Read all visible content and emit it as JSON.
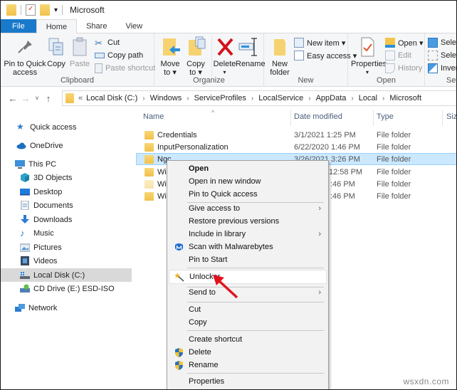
{
  "window": {
    "title": "Microsoft",
    "qat_dropdown": "▾"
  },
  "tabs": [
    {
      "label": "File"
    },
    {
      "label": "Home"
    },
    {
      "label": "Share"
    },
    {
      "label": "View"
    }
  ],
  "ribbon": {
    "clipboard": {
      "label": "Clipboard",
      "pin": "Pin to Quick access",
      "pin_line1": "Pin to Quick",
      "pin_line2": "access",
      "copy": "Copy",
      "paste": "Paste",
      "cut": "Cut",
      "copy_path": "Copy path",
      "paste_shortcut": "Paste shortcut"
    },
    "organize": {
      "label": "Organize",
      "move_to_1": "Move",
      "move_to_2": "to ▾",
      "copy_to_1": "Copy",
      "copy_to_2": "to ▾",
      "delete": "Delete",
      "delete_arrow": "▾",
      "rename": "Rename"
    },
    "new": {
      "label": "New",
      "new_folder_1": "New",
      "new_folder_2": "folder",
      "new_item": "New item ▾",
      "easy_access": "Easy access ▾"
    },
    "open": {
      "label": "Open",
      "properties": "Properties",
      "properties_arrow": "▾",
      "open": "Open ▾",
      "edit": "Edit",
      "history": "History"
    },
    "select": {
      "label": "Se",
      "select_all": "Selec",
      "select_none": "Selec",
      "invert": "Invert"
    }
  },
  "address": {
    "back": "←",
    "forward": "→",
    "recent": "˅",
    "up": "↑",
    "overflow": "«",
    "crumbs": [
      "Local Disk (C:)",
      "Windows",
      "ServiceProfiles",
      "LocalService",
      "AppData",
      "Local",
      "Microsoft"
    ],
    "separator": "›"
  },
  "navpane": {
    "items": [
      {
        "label": "Quick access",
        "icon": "star-icon"
      },
      {
        "label": "OneDrive",
        "icon": "cloud-icon"
      },
      {
        "label": "This PC",
        "icon": "computer-icon"
      },
      {
        "label": "3D Objects",
        "icon": "cube-icon"
      },
      {
        "label": "Desktop",
        "icon": "desktop-icon"
      },
      {
        "label": "Documents",
        "icon": "document-icon"
      },
      {
        "label": "Downloads",
        "icon": "download-icon"
      },
      {
        "label": "Music",
        "icon": "music-icon"
      },
      {
        "label": "Pictures",
        "icon": "picture-icon"
      },
      {
        "label": "Videos",
        "icon": "video-icon"
      },
      {
        "label": "Local Disk (C:)",
        "icon": "drive-icon",
        "selected": true
      },
      {
        "label": "CD Drive (E:) ESD-ISO",
        "icon": "cd-drive-icon"
      },
      {
        "label": "Network",
        "icon": "network-icon"
      }
    ]
  },
  "filelist": {
    "columns": [
      "Name",
      "Date modified",
      "Type",
      "Size"
    ],
    "sort_indicator": "^",
    "rows": [
      {
        "name": "Credentials",
        "date": "3/1/2021 1:25 PM",
        "type": "File folder"
      },
      {
        "name": "InputPersonalization",
        "date": "6/22/2020 1:46 PM",
        "type": "File folder"
      },
      {
        "name": "Ngc",
        "date": "3/26/2021 3:26 PM",
        "type": "File folder",
        "selected": true
      },
      {
        "name": "Win",
        "date": "12:58 PM",
        "type": "File folder"
      },
      {
        "name": "Win",
        "date": ":46 PM",
        "type": "File folder"
      },
      {
        "name": "Win",
        "date": ":46 PM",
        "type": "File folder"
      }
    ]
  },
  "context_menu": {
    "items": [
      {
        "label": "Open",
        "bold": true
      },
      {
        "label": "Open in new window"
      },
      {
        "label": "Pin to Quick access"
      },
      {
        "label": "Give access to",
        "submenu": true
      },
      {
        "label": "Restore previous versions"
      },
      {
        "label": "Include in library",
        "submenu": true
      },
      {
        "label": "Scan with Malwarebytes",
        "icon": "malwarebytes-icon"
      },
      {
        "label": "Pin to Start"
      },
      {
        "label": "Unlocker",
        "icon": "magic-wand-icon",
        "highlighted": true
      },
      {
        "label": "Send to",
        "submenu": true
      },
      {
        "label": "Cut"
      },
      {
        "label": "Copy"
      },
      {
        "label": "Create shortcut"
      },
      {
        "label": "Delete",
        "icon": "uac-shield-icon"
      },
      {
        "label": "Rename",
        "icon": "uac-shield-icon"
      },
      {
        "label": "Properties"
      }
    ],
    "submenu_arrow": "›"
  },
  "annotation": {
    "arrow_color": "#e0141e"
  },
  "watermark": "wsxdn.com",
  "colors": {
    "file_tab": "#1979ca",
    "selection": "#cce8ff",
    "selection_border": "#99d1ff",
    "folder": "#f0c14a"
  }
}
